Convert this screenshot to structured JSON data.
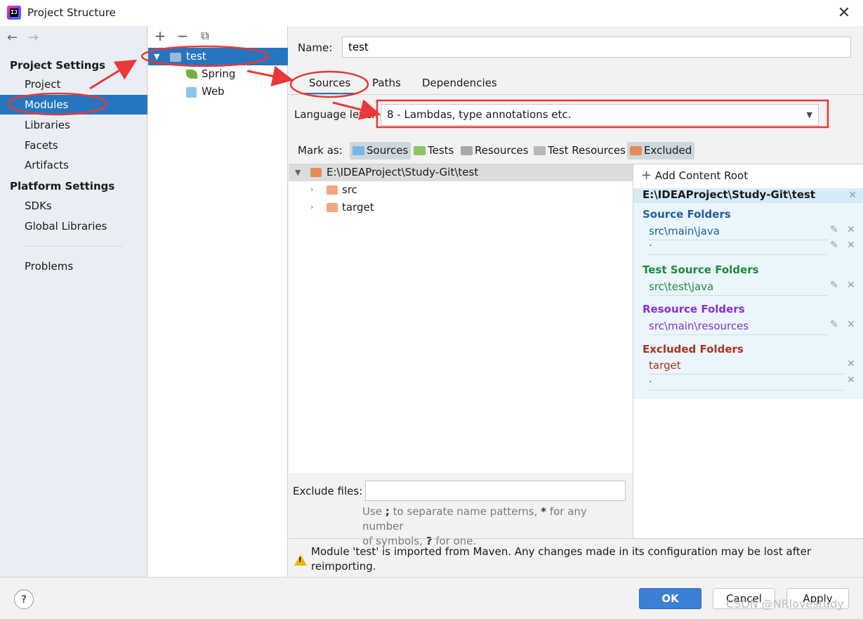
{
  "window": {
    "title": "Project Structure",
    "close_label": "✕"
  },
  "colors": {
    "accent": "#2675bf",
    "annotation": "#e83838",
    "source": "#1f5fa0",
    "test": "#1f8a3a",
    "resource": "#8a30c9",
    "excluded": "#a8331b"
  },
  "nav": {
    "back": "←",
    "forward": "→"
  },
  "left": {
    "project_settings": "Project Settings",
    "platform_settings": "Platform Settings",
    "items": [
      "Project",
      "Modules",
      "Libraries",
      "Facets",
      "Artifacts"
    ],
    "platform_items": [
      "SDKs",
      "Global Libraries"
    ],
    "problems": "Problems"
  },
  "modules": {
    "toolbar": {
      "add": "+",
      "remove": "−",
      "copy": "⧉"
    },
    "tree": {
      "root": "test",
      "children": [
        "Spring",
        "Web"
      ]
    }
  },
  "content": {
    "name_label": "Name:",
    "name_value": "test",
    "tabs": [
      "Sources",
      "Paths",
      "Dependencies"
    ],
    "language_level_label": "Language level:",
    "language_level_value": "8 - Lambdas, type annotations etc.",
    "mark_as_label": "Mark as:",
    "mark_buttons": [
      "Sources",
      "Tests",
      "Resources",
      "Test Resources",
      "Excluded"
    ],
    "tree": {
      "root": "E:\\IDEAProject\\Study-Git\\test",
      "children": [
        "src",
        "target"
      ]
    },
    "exclude_files_label": "Exclude files:",
    "hint_line1_a": "Use ",
    "hint_semicolon": ";",
    "hint_line1_b": " to separate name patterns, ",
    "hint_star": "*",
    "hint_line1_c": " for any number",
    "hint_line2_a": "of symbols, ",
    "hint_question": "?",
    "hint_line2_b": " for one.",
    "warning": "Module 'test' is imported from Maven. Any changes made in its configuration may be lost after reimporting."
  },
  "content_roots": {
    "add_label": "Add Content Root",
    "add_icon": "+",
    "root_path": "E:\\IDEAProject\\Study-Git\\test",
    "source_title": "Source Folders",
    "source_items": [
      "src\\main\\java",
      "."
    ],
    "test_title": "Test Source Folders",
    "test_items": [
      "src\\test\\java"
    ],
    "resource_title": "Resource Folders",
    "resource_items": [
      "src\\main\\resources"
    ],
    "excluded_title": "Excluded Folders",
    "excluded_items": [
      "target",
      "."
    ],
    "edit_icon": "✎",
    "remove_icon": "✕"
  },
  "footer": {
    "help": "?",
    "ok": "OK",
    "cancel": "Cancel",
    "apply": "Apply"
  },
  "watermark": "CSDN @NRlovestudy"
}
